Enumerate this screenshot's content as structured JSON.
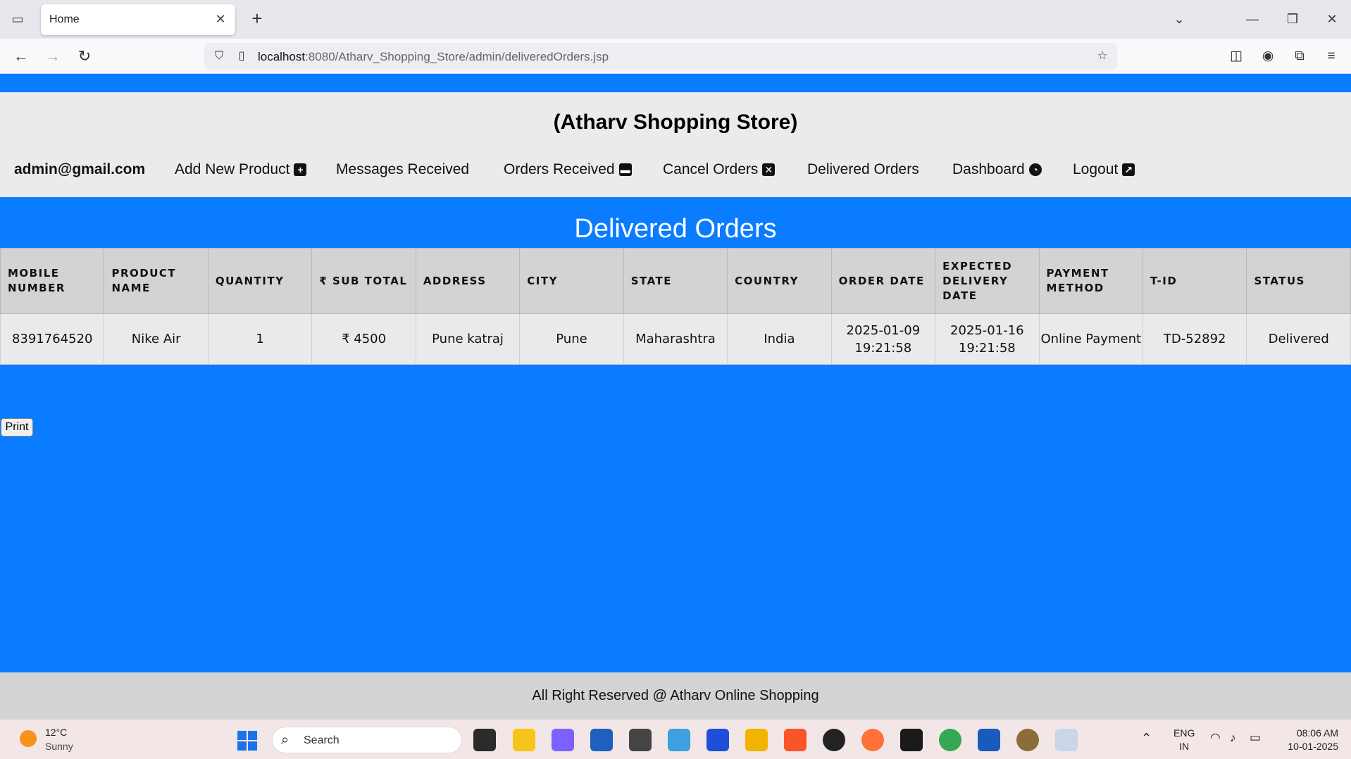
{
  "browser": {
    "tab_title": "Home",
    "url_host": "localhost",
    "url_path": ":8080/Atharv_Shopping_Store/admin/deliveredOrders.jsp"
  },
  "site": {
    "brand": "(Atharv Shopping Store)",
    "user": "admin@gmail.com",
    "menu": [
      {
        "label": "Add New Product",
        "icon": "plus-square-icon"
      },
      {
        "label": "Messages Received"
      },
      {
        "label": "Orders Received",
        "icon": "archive-icon"
      },
      {
        "label": "Cancel Orders",
        "icon": "x-square-icon"
      },
      {
        "label": "Delivered Orders"
      },
      {
        "label": "Dashboard",
        "icon": "dashboard-icon"
      },
      {
        "label": "Logout",
        "icon": "external-link-icon"
      }
    ]
  },
  "page": {
    "title": "Delivered Orders",
    "columns": [
      "MOBILE NUMBER",
      "PRODUCT NAME",
      "QUANTITY",
      "₹ SUB TOTAL",
      "ADDRESS",
      "CITY",
      "STATE",
      "COUNTRY",
      "ORDER DATE",
      "EXPECTED DELIVERY DATE",
      "PAYMENT METHOD",
      "T-ID",
      "STATUS"
    ],
    "rows": [
      [
        "8391764520",
        "Nike Air",
        "1",
        "₹ 4500",
        "Pune katraj",
        "Pune",
        "Maharashtra",
        "India",
        "2025-01-09 19:21:58",
        "2025-01-16 19:21:58",
        "Online Payment",
        "TD-52892",
        "Delivered"
      ]
    ],
    "print_label": "Print",
    "footer": "All Right Reserved @ Atharv Online Shopping"
  },
  "taskbar": {
    "weather_temp": "12°C",
    "weather_desc": "Sunny",
    "search_label": "Search",
    "lang_line1": "ENG",
    "lang_line2": "IN",
    "time": "08:06 AM",
    "date": "10-01-2025"
  },
  "colors": {
    "page_bg": "#0a7cff",
    "header_bg": "#ebebeb",
    "table_header_bg": "#d3d3d3",
    "table_cell_bg": "#eaeaea"
  }
}
